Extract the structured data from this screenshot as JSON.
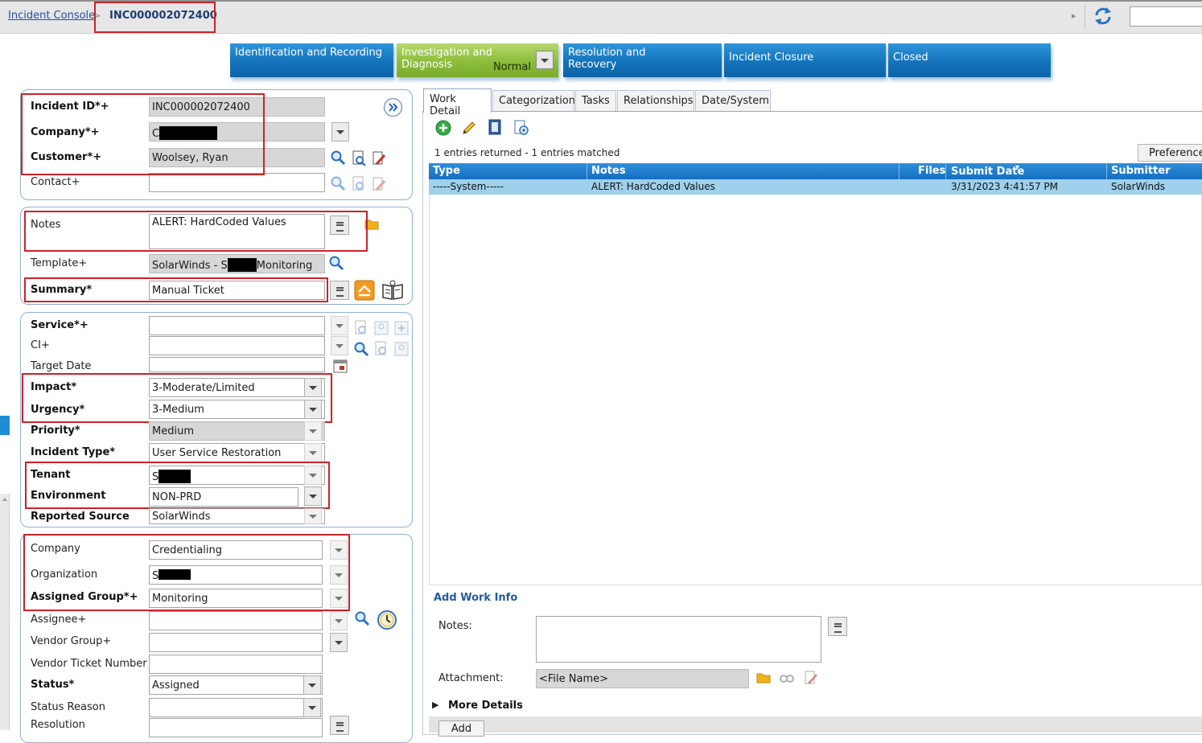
{
  "breadcrumb": {
    "root": "Incident Console",
    "separator": ">",
    "current": "INC000002072400"
  },
  "process_flow": {
    "stages": [
      {
        "label": "Identification and Recording"
      },
      {
        "label": "Investigation and Diagnosis",
        "status": "Normal"
      },
      {
        "label": "Resolution and Recovery"
      },
      {
        "label": "Incident Closure"
      },
      {
        "label": "Closed"
      }
    ]
  },
  "form": {
    "incident_id": {
      "label": "Incident ID*+",
      "value": "INC000002072400"
    },
    "company": {
      "label": "Company*+",
      "value": "C"
    },
    "customer": {
      "label": "Customer*+",
      "value": "Woolsey, Ryan"
    },
    "contact": {
      "label": "Contact+",
      "value": ""
    },
    "notes": {
      "label": "Notes",
      "value": "ALERT: HardCoded Values"
    },
    "template": {
      "label": "Template+",
      "value_prefix": "SolarWinds - S",
      "value_suffix": "Monitoring"
    },
    "summary": {
      "label": "Summary*",
      "value": "Manual Ticket"
    },
    "service": {
      "label": "Service*+",
      "value": ""
    },
    "ci": {
      "label": "CI+",
      "value": ""
    },
    "target_date": {
      "label": "Target Date",
      "value": ""
    },
    "impact": {
      "label": "Impact*",
      "value": "3-Moderate/Limited"
    },
    "urgency": {
      "label": "Urgency*",
      "value": "3-Medium"
    },
    "priority": {
      "label": "Priority*",
      "value": "Medium"
    },
    "incident_type": {
      "label": "Incident Type*",
      "value": "User Service Restoration"
    },
    "tenant": {
      "label": "Tenant",
      "value": "S"
    },
    "environment": {
      "label": "Environment",
      "value": "NON-PRD"
    },
    "reported_source": {
      "label": "Reported Source",
      "value": "SolarWinds"
    },
    "assign_company": {
      "label": "Company",
      "value": "Credentialing"
    },
    "organization": {
      "label": "Organization",
      "value": "S"
    },
    "assigned_group": {
      "label": "Assigned Group*+",
      "value": "Monitoring"
    },
    "assignee": {
      "label": "Assignee+",
      "value": ""
    },
    "vendor_group": {
      "label": "Vendor Group+",
      "value": ""
    },
    "vendor_ticket": {
      "label": "Vendor Ticket Number",
      "value": ""
    },
    "status": {
      "label": "Status*",
      "value": "Assigned"
    },
    "status_reason": {
      "label": "Status Reason",
      "value": ""
    },
    "resolution": {
      "label": "Resolution",
      "value": ""
    }
  },
  "tabs": [
    "Work Detail",
    "Categorization",
    "Tasks",
    "Relationships",
    "Date/System"
  ],
  "work_detail": {
    "summary": "1 entries returned - 1 entries matched",
    "preferences_label": "Preferences",
    "columns": [
      "Type",
      "Notes",
      "Files",
      "Submit Date",
      "Submitter"
    ],
    "rows": [
      {
        "type": "-----System-----",
        "notes": "ALERT: HardCoded Values",
        "files": "",
        "submit_date": "3/31/2023 4:41:57 PM",
        "submitter": "SolarWinds"
      }
    ]
  },
  "add_work_info": {
    "title": "Add Work Info",
    "notes_label": "Notes:",
    "notes_value": "",
    "attachment_label": "Attachment:",
    "attachment_value": "<File Name>",
    "more_details_label": "More Details",
    "add_label": "Add"
  },
  "colors": {
    "accent_blue": "#1473bc",
    "active_stage": "#8cbd3a",
    "highlight_red": "#cc2229",
    "row_selected": "#9fd0ec"
  }
}
